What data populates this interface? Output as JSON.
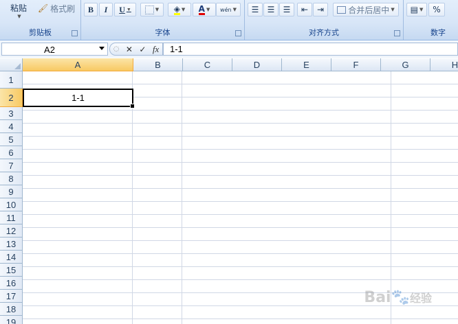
{
  "ribbon": {
    "clipboard": {
      "paste_label": "粘贴",
      "format_painter_label": "格式刷",
      "group_label": "剪贴板"
    },
    "font": {
      "bold": "B",
      "italic": "I",
      "underline": "U",
      "font_color_glyph": "A",
      "phonetic_glyph": "wén",
      "group_label": "字体"
    },
    "alignment": {
      "merge_center_label": "合并后居中",
      "group_label": "对齐方式"
    },
    "number": {
      "percent": "%",
      "group_label": "数字"
    }
  },
  "formula_bar": {
    "name_box": "A2",
    "fx": "fx",
    "content": "1-1"
  },
  "columns": [
    "A",
    "B",
    "C",
    "D",
    "E",
    "F",
    "G",
    "H"
  ],
  "rows": [
    "1",
    "2",
    "3",
    "4",
    "5",
    "6",
    "7",
    "8",
    "9",
    "10",
    "11",
    "12",
    "13",
    "14",
    "15",
    "16",
    "17",
    "18",
    "19"
  ],
  "selected_cell": {
    "ref": "A2",
    "value": "1-1"
  },
  "watermark": {
    "text": "Bai",
    "sub": "经验"
  },
  "colors": {
    "accent": "#f8c963",
    "ribbon": "#d7e5f7",
    "gridline": "#d0d7e5",
    "header_border": "#9eb6ce"
  }
}
